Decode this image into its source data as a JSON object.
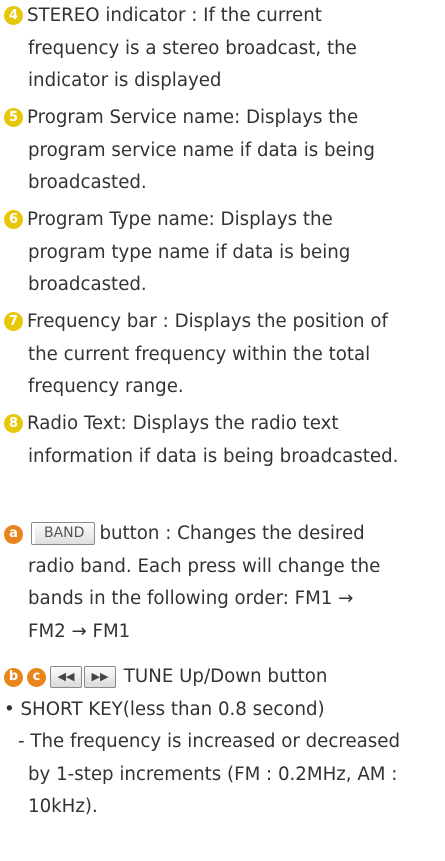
{
  "items": [
    {
      "marker": "4",
      "lines": [
        "STEREO indicator : If the current",
        "frequency is a stereo broadcast, the",
        "indicator is displayed"
      ]
    },
    {
      "marker": "5",
      "lines": [
        "Program Service name: Displays the",
        "program service name if data is being",
        "broadcasted."
      ]
    },
    {
      "marker": "6",
      "lines": [
        "Program Type name: Displays the",
        "program type name if data is being",
        "broadcasted."
      ]
    },
    {
      "marker": "7",
      "lines": [
        "Frequency bar : Displays the position of",
        "the current frequency within the total",
        "frequency range."
      ]
    },
    {
      "marker": "8",
      "lines": [
        "Radio Text: Displays the radio text",
        "information if data is being broadcasted."
      ]
    }
  ],
  "band": {
    "marker": "a",
    "key_label": "BAND",
    "first_line": "button : Changes the desired",
    "lines": [
      "radio band. Each press will change the",
      "bands in the following order: FM1 →",
      "FM2 → FM1"
    ]
  },
  "tune": {
    "markers": [
      "b",
      "c"
    ],
    "left_icon": "rewind-icon",
    "right_icon": "fast-forward-icon",
    "left_glyph": "◀◀",
    "right_glyph": "▶▶",
    "label": "TUNE Up/Down button",
    "short_key": "• SHORT KEY(less than 0.8 second)",
    "lines": [
      "- The frequency is increased or decreased",
      "by 1-step increments (FM : 0.2MHz, AM :",
      "10kHz)."
    ]
  },
  "colors": {
    "number_badge": "#e8c60a",
    "letter_badge": "#e8851c",
    "text": "#333333"
  }
}
